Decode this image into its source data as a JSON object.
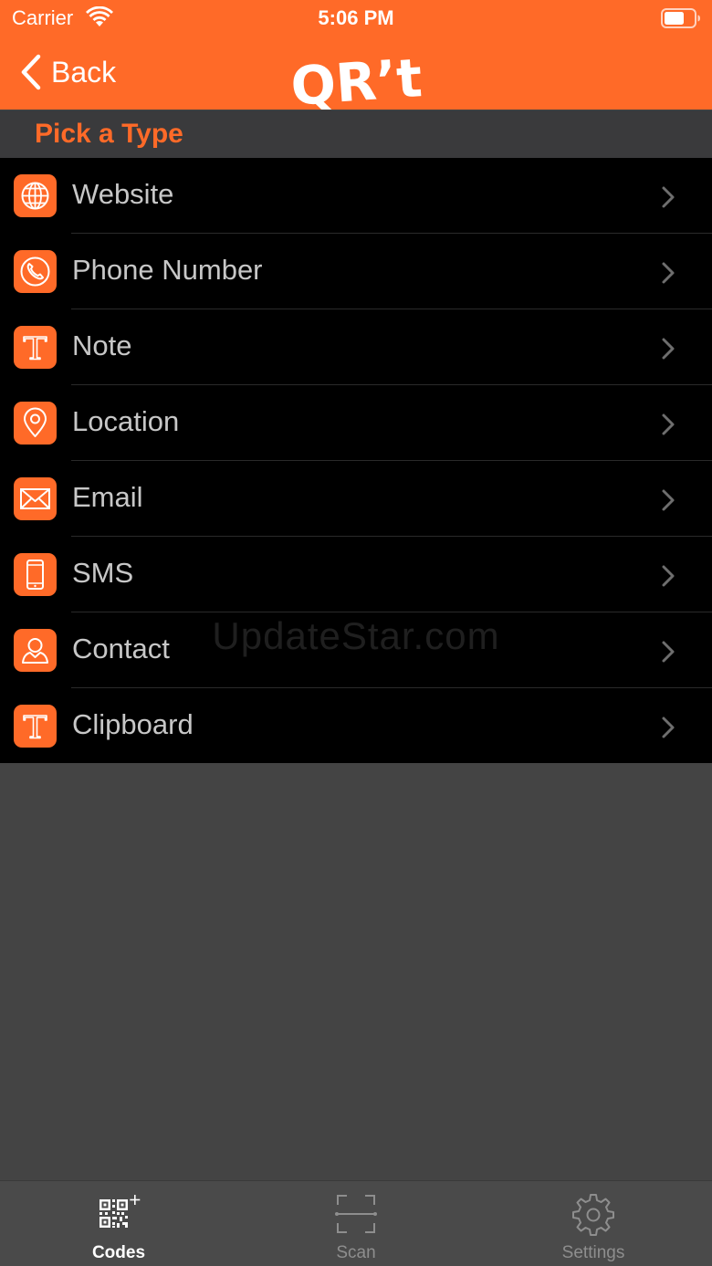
{
  "status_bar": {
    "carrier": "Carrier",
    "time": "5:06 PM"
  },
  "nav": {
    "back_label": "Back",
    "logo_text": "QR’t"
  },
  "section": {
    "title": "Pick a Type"
  },
  "types": [
    {
      "label": "Website",
      "icon": "globe-icon"
    },
    {
      "label": "Phone Number",
      "icon": "phone-icon"
    },
    {
      "label": "Note",
      "icon": "text-icon"
    },
    {
      "label": "Location",
      "icon": "location-pin-icon"
    },
    {
      "label": "Email",
      "icon": "envelope-icon"
    },
    {
      "label": "SMS",
      "icon": "mobile-phone-icon"
    },
    {
      "label": "Contact",
      "icon": "person-icon"
    },
    {
      "label": "Clipboard",
      "icon": "text-icon"
    }
  ],
  "watermark": "UpdateStar.com",
  "tabs": [
    {
      "label": "Codes",
      "icon": "qr-code-add-icon",
      "selected": true
    },
    {
      "label": "Scan",
      "icon": "scan-frame-icon",
      "selected": false
    },
    {
      "label": "Settings",
      "icon": "gear-icon",
      "selected": false
    }
  ],
  "colors": {
    "accent": "#ff6a28",
    "list_background": "#000000",
    "section_background": "#3a3a3c",
    "page_background": "#444444",
    "row_text": "#c7c7c7"
  }
}
